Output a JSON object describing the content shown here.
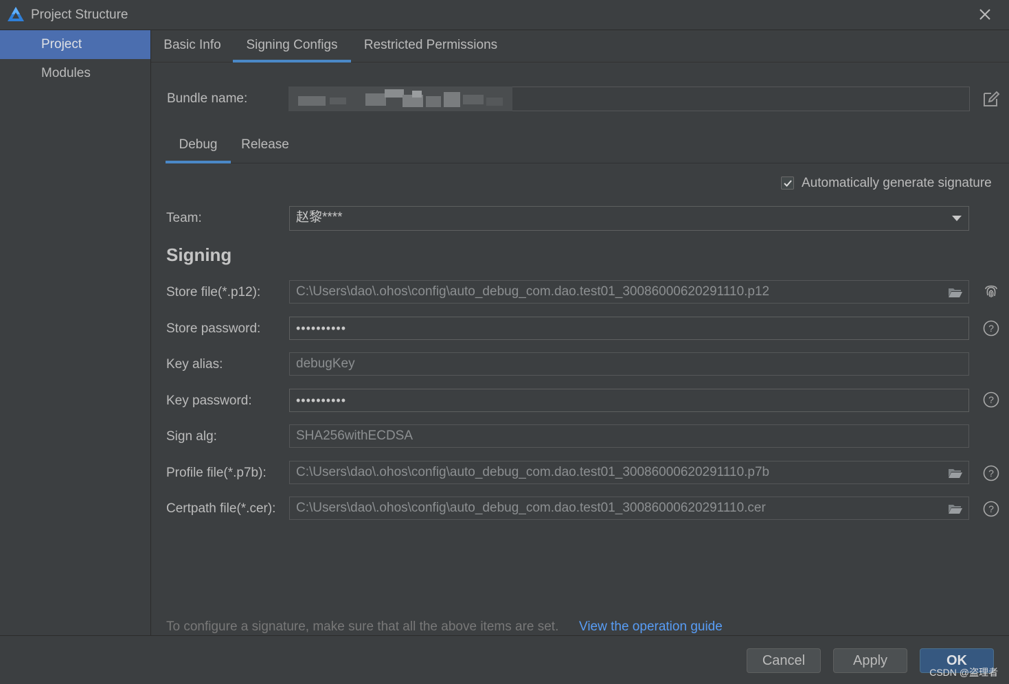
{
  "window": {
    "title": "Project Structure"
  },
  "sidebar": {
    "items": [
      {
        "label": "Project"
      },
      {
        "label": "Modules"
      }
    ]
  },
  "tabs": [
    {
      "label": "Basic Info"
    },
    {
      "label": "Signing Configs"
    },
    {
      "label": "Restricted Permissions"
    }
  ],
  "bundle": {
    "label": "Bundle name:",
    "value": ""
  },
  "subtabs": [
    {
      "label": "Debug"
    },
    {
      "label": "Release"
    }
  ],
  "auto_signature": {
    "label": "Automatically generate signature",
    "checked": true
  },
  "team": {
    "label": "Team:",
    "value": "赵黎****"
  },
  "signing": {
    "title": "Signing",
    "store_file": {
      "label": "Store file(*.p12):",
      "value": "C:\\Users\\dao\\.ohos\\config\\auto_debug_com.dao.test01_30086000620291110.p12"
    },
    "store_password": {
      "label": "Store password:",
      "value": "••••••••••"
    },
    "key_alias": {
      "label": "Key alias:",
      "value": "debugKey"
    },
    "key_password": {
      "label": "Key password:",
      "value": "••••••••••"
    },
    "sign_alg": {
      "label": "Sign alg:",
      "value": "SHA256withECDSA"
    },
    "profile_file": {
      "label": "Profile file(*.p7b):",
      "value": "C:\\Users\\dao\\.ohos\\config\\auto_debug_com.dao.test01_30086000620291110.p7b"
    },
    "certpath_file": {
      "label": "Certpath file(*.cer):",
      "value": "C:\\Users\\dao\\.ohos\\config\\auto_debug_com.dao.test01_30086000620291110.cer"
    }
  },
  "hint": {
    "text": "To configure a signature, make sure that all the above items are set.",
    "link": "View the operation guide"
  },
  "buttons": {
    "cancel": "Cancel",
    "apply": "Apply",
    "ok": "OK"
  },
  "watermark": "CSDN @盗理者",
  "colors": {
    "accent": "#4a88c7",
    "selection": "#4b6eaf",
    "link": "#589df6",
    "background": "#3c3f41"
  }
}
